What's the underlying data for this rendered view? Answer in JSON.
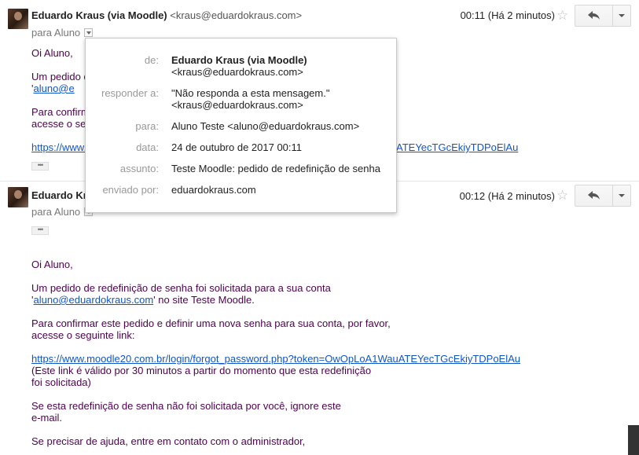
{
  "messages": [
    {
      "sender_name": "Eduardo Kraus (via Moodle)",
      "sender_email": "<kraus@eduardokraus.com>",
      "to": "para Aluno",
      "time": "00:11 (Há 2 minutos)"
    },
    {
      "sender_name": "Eduardo Kraus",
      "to": "para Aluno",
      "time": "00:12 (Há 2 minutos)"
    }
  ],
  "collapsed_body": {
    "greeting": "Oi Aluno,",
    "line1": "Um pedido d",
    "line2_prefix": "'",
    "line2_link": "aluno@e",
    "line3": "Para confirm",
    "line4": "acesse o se",
    "link": "https://www.",
    "link_tail": "ATEYecTGcEkiyTDPoElAu"
  },
  "details_popup": {
    "from_label": "de:",
    "from_name": "Eduardo Kraus (via Moodle)",
    "from_email": "<kraus@eduardokraus.com>",
    "reply_label": "responder a:",
    "reply_name": "\"Não responda a esta mensagem.\"",
    "reply_email": "<kraus@eduardokraus.com>",
    "to_label": "para:",
    "to_value": "Aluno Teste <aluno@eduardokraus.com>",
    "date_label": "data:",
    "date_value": "24 de outubro de 2017 00:11",
    "subject_label": "assunto:",
    "subject_value": "Teste Moodle: pedido de redefinição de senha",
    "sent_by_label": "enviado por:",
    "sent_by_value": "eduardokraus.com"
  },
  "email_body": {
    "greeting": "Oi Aluno,",
    "p1_line1": "Um pedido de redefinição de senha foi solicitada para a sua conta",
    "p1_quote_open": "'",
    "p1_link": "aluno@eduardokraus.com",
    "p1_rest": "' no site Teste Moodle.",
    "p2_line1": "Para confirmar este pedido e definir uma nova senha para sua conta, por favor,",
    "p2_line2": "acesse o seguinte link:",
    "reset_link": "https://www.moodle20.com.br/login/forgot_password.php?token=OwOpLoA1WauATEYecTGcEkiyTDPoElAu",
    "validity_line1": "(Este link é válido por 30 minutos a partir do momento que esta redefinição",
    "validity_line2": "foi solicitada)",
    "p3_line1": "Se esta redefinição de senha não foi solicitada por você, ignore este",
    "p3_line2": "e-mail.",
    "p4_line1": "Se precisar de ajuda, entre em contato com o administrador,"
  },
  "icons": {
    "star": "star-outline-icon",
    "reply": "reply-arrow-icon",
    "more": "chevron-down-icon",
    "dropdown": "details-dropdown-icon",
    "ellipsis": "show-trimmed-content-icon"
  },
  "colors": {
    "body_text": "#500050",
    "link": "#1155cc",
    "label_gray": "#999999"
  },
  "ellipsis_text": "•••"
}
